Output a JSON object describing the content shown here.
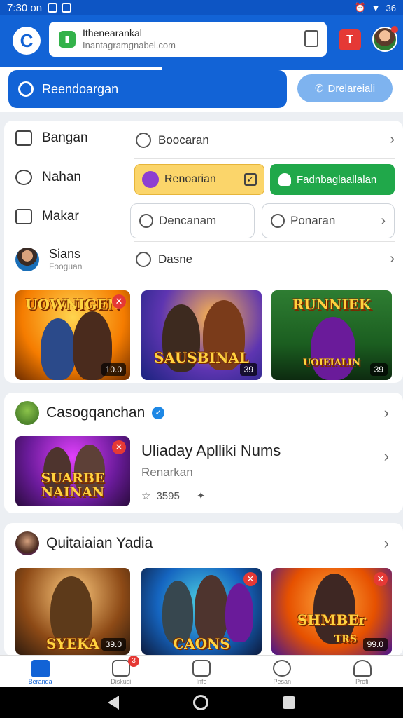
{
  "status": {
    "time": "7:30 on",
    "battery": "36"
  },
  "header": {
    "url_title": "Ithenearankal",
    "url_sub": "Inantagramgnabel.com",
    "notif_label": "T"
  },
  "search": {
    "main_label": "Reendoargan",
    "pill_label": "Drelareiali"
  },
  "menu": {
    "left": [
      "Bangan",
      "Nahan",
      "Makar"
    ],
    "profile_name": "Sians",
    "profile_sub": "Fooguan",
    "row1": "Boocaran",
    "yellow_btn": "Renoarian",
    "green_btn": "Fadnbaglaallalan",
    "outline1": "Dencanam",
    "outline2": "Ponaran",
    "row_last": "Dasne"
  },
  "thumbs_top": [
    {
      "title": "UOWNIGEN",
      "badge": "10.0"
    },
    {
      "title": "SAUSBINAL",
      "badge": "39"
    },
    {
      "title": "RUNNIEK",
      "badge": "39",
      "subtitle": "UOIEIALIN"
    }
  ],
  "section2": {
    "title": "Casogqanchan",
    "app_title": "Uliaday Aplliki Nums",
    "app_sub": "Renarkan",
    "rating": "3595",
    "thumb_title": "SUARBE NAINAN"
  },
  "section3": {
    "title": "Quitaiaian Yadia",
    "thumbs": [
      {
        "title": "SYEKA",
        "badge": "39.0"
      },
      {
        "title": "CAONS",
        "badge": ""
      },
      {
        "title": "SHMBEr",
        "badge": "99.0",
        "subtitle": "TRS"
      }
    ]
  },
  "bottom_nav": [
    {
      "label": "Beranda"
    },
    {
      "label": "Diskusi",
      "badge": "3"
    },
    {
      "label": "Info"
    },
    {
      "label": "Pesan"
    },
    {
      "label": "Profil"
    }
  ],
  "colors": {
    "primary": "#1263d6",
    "green": "#20a84a",
    "yellow": "#fbd56a",
    "red": "#e53935"
  }
}
